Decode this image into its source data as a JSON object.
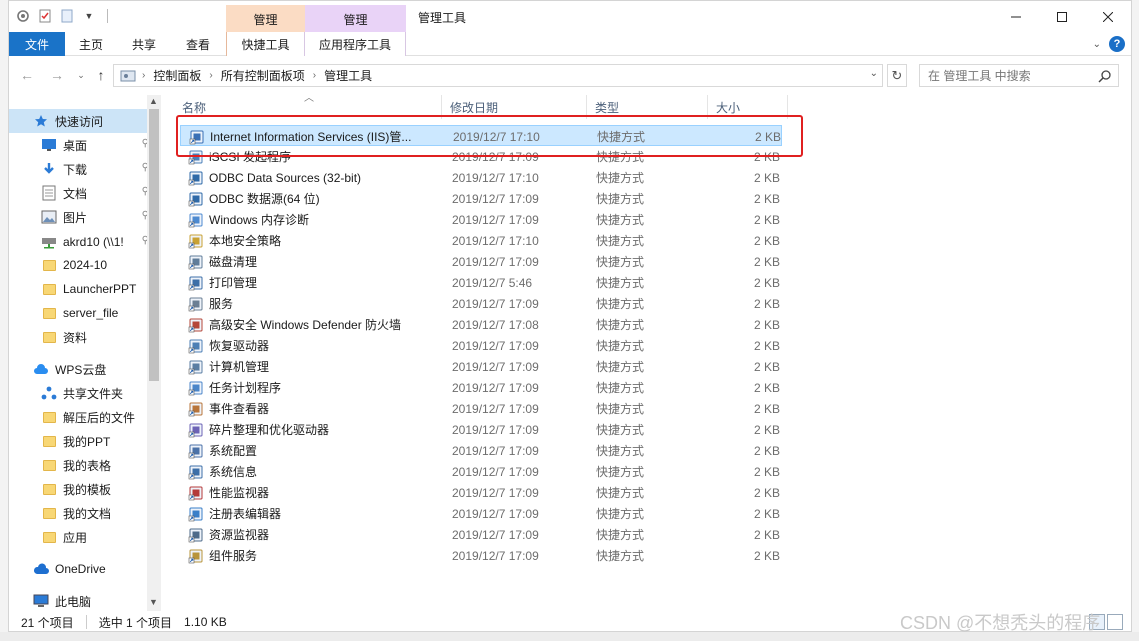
{
  "window": {
    "title": "管理工具",
    "context_group_1": "管理",
    "context_group_2": "管理"
  },
  "ribbon": {
    "tabs": [
      "文件",
      "主页",
      "共享",
      "查看",
      "快捷工具",
      "应用程序工具"
    ]
  },
  "address": {
    "crumbs": [
      "控制面板",
      "所有控制面板项",
      "管理工具"
    ],
    "search_placeholder": "在 管理工具 中搜索"
  },
  "navpane": {
    "items": [
      {
        "label": "快速访问",
        "icon": "star-icon"
      },
      {
        "label": "桌面",
        "icon": "desktop-icon",
        "pinned": true
      },
      {
        "label": "下载",
        "icon": "download-icon",
        "pinned": true
      },
      {
        "label": "文档",
        "icon": "document-icon",
        "pinned": true
      },
      {
        "label": "图片",
        "icon": "pictures-icon",
        "pinned": true
      },
      {
        "label": "akrd10 (\\\\1!",
        "icon": "network-drive-icon",
        "pinned": true
      },
      {
        "label": "2024-10",
        "icon": "folder-icon"
      },
      {
        "label": "LauncherPPT",
        "icon": "folder-icon"
      },
      {
        "label": "server_file",
        "icon": "folder-icon"
      },
      {
        "label": "资料",
        "icon": "folder-icon"
      },
      {
        "label": "WPS云盘",
        "icon": "cloud-icon"
      },
      {
        "label": "共享文件夹",
        "icon": "share-icon"
      },
      {
        "label": "解压后的文件",
        "icon": "folder-icon"
      },
      {
        "label": "我的PPT",
        "icon": "folder-icon"
      },
      {
        "label": "我的表格",
        "icon": "folder-icon"
      },
      {
        "label": "我的模板",
        "icon": "folder-icon"
      },
      {
        "label": "我的文档",
        "icon": "folder-icon"
      },
      {
        "label": "应用",
        "icon": "folder-icon"
      },
      {
        "label": "OneDrive",
        "icon": "onedrive-icon"
      },
      {
        "label": "此电脑",
        "icon": "computer-icon"
      }
    ]
  },
  "list": {
    "columns": [
      "名称",
      "修改日期",
      "类型",
      "大小"
    ],
    "rows": [
      {
        "name": "Internet Information Services (IIS)管...",
        "date": "2019/12/7 17:10",
        "type": "快捷方式",
        "size": "2 KB",
        "selected": true
      },
      {
        "name": "iSCSI 发起程序",
        "date": "2019/12/7 17:09",
        "type": "快捷方式",
        "size": "2 KB"
      },
      {
        "name": "ODBC Data Sources (32-bit)",
        "date": "2019/12/7 17:10",
        "type": "快捷方式",
        "size": "2 KB"
      },
      {
        "name": "ODBC 数据源(64 位)",
        "date": "2019/12/7 17:09",
        "type": "快捷方式",
        "size": "2 KB"
      },
      {
        "name": "Windows 内存诊断",
        "date": "2019/12/7 17:09",
        "type": "快捷方式",
        "size": "2 KB"
      },
      {
        "name": "本地安全策略",
        "date": "2019/12/7 17:10",
        "type": "快捷方式",
        "size": "2 KB"
      },
      {
        "name": "磁盘清理",
        "date": "2019/12/7 17:09",
        "type": "快捷方式",
        "size": "2 KB"
      },
      {
        "name": "打印管理",
        "date": "2019/12/7 5:46",
        "type": "快捷方式",
        "size": "2 KB"
      },
      {
        "name": "服务",
        "date": "2019/12/7 17:09",
        "type": "快捷方式",
        "size": "2 KB"
      },
      {
        "name": "高级安全 Windows Defender 防火墙",
        "date": "2019/12/7 17:08",
        "type": "快捷方式",
        "size": "2 KB"
      },
      {
        "name": "恢复驱动器",
        "date": "2019/12/7 17:09",
        "type": "快捷方式",
        "size": "2 KB"
      },
      {
        "name": "计算机管理",
        "date": "2019/12/7 17:09",
        "type": "快捷方式",
        "size": "2 KB"
      },
      {
        "name": "任务计划程序",
        "date": "2019/12/7 17:09",
        "type": "快捷方式",
        "size": "2 KB"
      },
      {
        "name": "事件查看器",
        "date": "2019/12/7 17:09",
        "type": "快捷方式",
        "size": "2 KB"
      },
      {
        "name": "碎片整理和优化驱动器",
        "date": "2019/12/7 17:09",
        "type": "快捷方式",
        "size": "2 KB"
      },
      {
        "name": "系统配置",
        "date": "2019/12/7 17:09",
        "type": "快捷方式",
        "size": "2 KB"
      },
      {
        "name": "系统信息",
        "date": "2019/12/7 17:09",
        "type": "快捷方式",
        "size": "2 KB"
      },
      {
        "name": "性能监视器",
        "date": "2019/12/7 17:09",
        "type": "快捷方式",
        "size": "2 KB"
      },
      {
        "name": "注册表编辑器",
        "date": "2019/12/7 17:09",
        "type": "快捷方式",
        "size": "2 KB"
      },
      {
        "name": "资源监视器",
        "date": "2019/12/7 17:09",
        "type": "快捷方式",
        "size": "2 KB"
      },
      {
        "name": "组件服务",
        "date": "2019/12/7 17:09",
        "type": "快捷方式",
        "size": "2 KB"
      }
    ]
  },
  "status": {
    "count": "21 个项目",
    "selection": "选中 1 个项目",
    "size": "1.10 KB"
  },
  "watermark": "CSDN @不想秃头的程序",
  "colors": {
    "accent": "#1a73c8",
    "selection": "#cce8ff",
    "highlight_box": "#e02020"
  }
}
